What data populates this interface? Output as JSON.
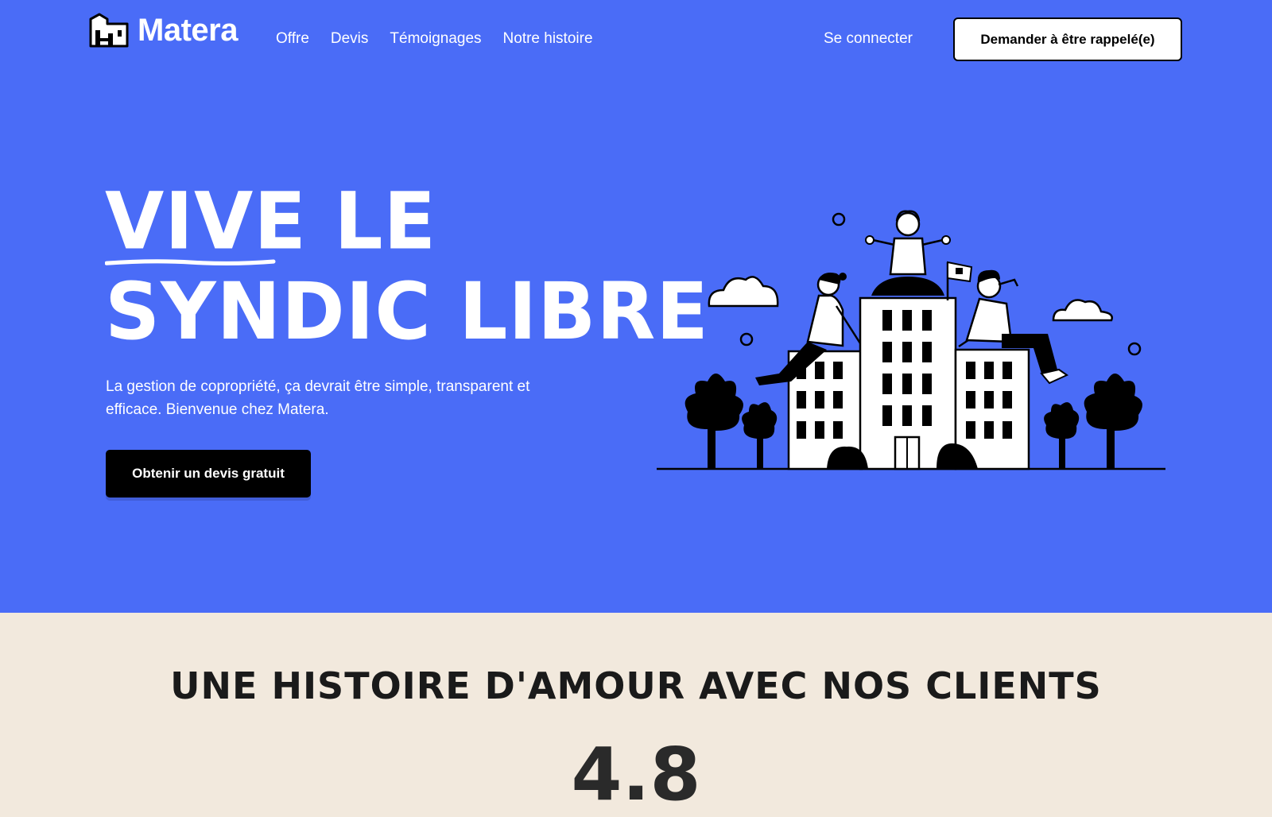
{
  "brand": {
    "name": "Matera",
    "logo_icon": "building-icon"
  },
  "nav": {
    "items": [
      {
        "label": "Offre"
      },
      {
        "label": "Devis"
      },
      {
        "label": "Témoignages"
      },
      {
        "label": "Notre histoire"
      }
    ],
    "login_label": "Se connecter",
    "callback_button": "Demander à être rappelé(e)"
  },
  "hero": {
    "headline_line1_a": "VIVE",
    "headline_line1_b": "LE",
    "headline_line2": "SYNDIC LIBRE",
    "subtitle": "La gestion de copropriété, ça devrait être simple, transparent et efficace. Bienvenue chez Matera.",
    "cta_label": "Obtenir un devis gratuit",
    "illustration": "people-on-buildings-illustration"
  },
  "testimonials": {
    "title": "UNE HISTOIRE D'AMOUR AVEC NOS CLIENTS",
    "rating": "4.8"
  },
  "colors": {
    "hero_background": "#4a6cf7",
    "page_background": "#f2e9dd",
    "text_dark": "#1a1a1a"
  }
}
